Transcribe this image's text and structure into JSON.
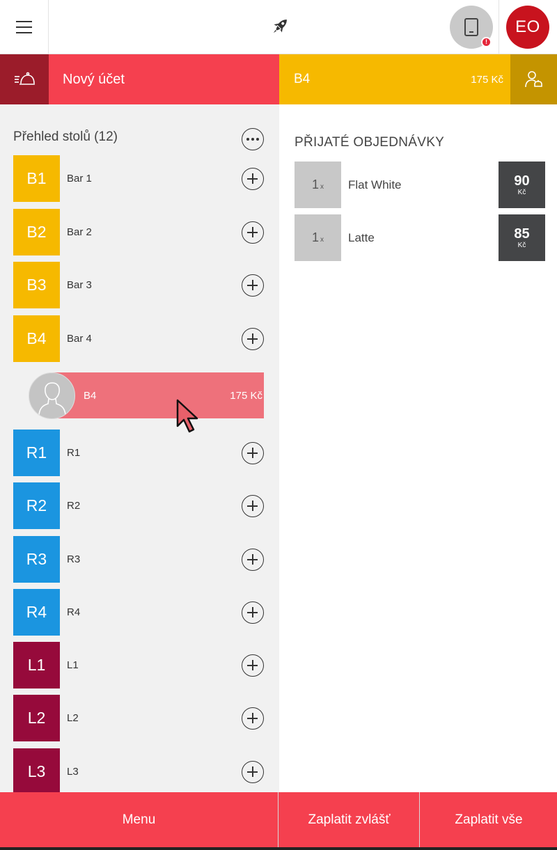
{
  "topbar": {
    "menu_icon": "hamburger-icon",
    "center_icon": "rocket-icon",
    "device_icon": "tablet-icon",
    "device_alert": "!",
    "user_initials": "EO"
  },
  "subbar": {
    "waiter_icon": "cloche-icon",
    "new_account_label": "Nový účet",
    "selected_table": "B4",
    "selected_total": "175 Kč",
    "customer_icon": "customer-icon"
  },
  "tables": {
    "title": "Přehled stolů (12)",
    "items": [
      {
        "code": "B1",
        "name": "Bar 1",
        "color": "#f6b900"
      },
      {
        "code": "B2",
        "name": "Bar 2",
        "color": "#f6b900"
      },
      {
        "code": "B3",
        "name": "Bar 3",
        "color": "#f6b900"
      },
      {
        "code": "B4",
        "name": "Bar 4",
        "color": "#f6b900"
      },
      {
        "code": "R1",
        "name": "R1",
        "color": "#1b95e0"
      },
      {
        "code": "R2",
        "name": "R2",
        "color": "#1b95e0"
      },
      {
        "code": "R3",
        "name": "R3",
        "color": "#1b95e0"
      },
      {
        "code": "R4",
        "name": "R4",
        "color": "#1b95e0"
      },
      {
        "code": "L1",
        "name": "L1",
        "color": "#960a3b"
      },
      {
        "code": "L2",
        "name": "L2",
        "color": "#960a3b"
      },
      {
        "code": "L3",
        "name": "L3",
        "color": "#960a3b"
      }
    ],
    "open_account": {
      "name": "B4",
      "total": "175 Kč"
    }
  },
  "orders": {
    "title": "PŘIJATÉ OBJEDNÁVKY",
    "items": [
      {
        "qty": "1",
        "qty_suffix": "x",
        "name": "Flat White",
        "price": "90",
        "currency": "Kč"
      },
      {
        "qty": "1",
        "qty_suffix": "x",
        "name": "Latte",
        "price": "85",
        "currency": "Kč"
      }
    ]
  },
  "bottombar": {
    "menu": "Menu",
    "pay_split": "Zaplatit zvlášť",
    "pay_all": "Zaplatit vše"
  },
  "colors": {
    "primary_red": "#f5404f",
    "bar_yellow": "#f6b900",
    "room_blue": "#1b95e0",
    "lounge_burgundy": "#960a3b"
  }
}
